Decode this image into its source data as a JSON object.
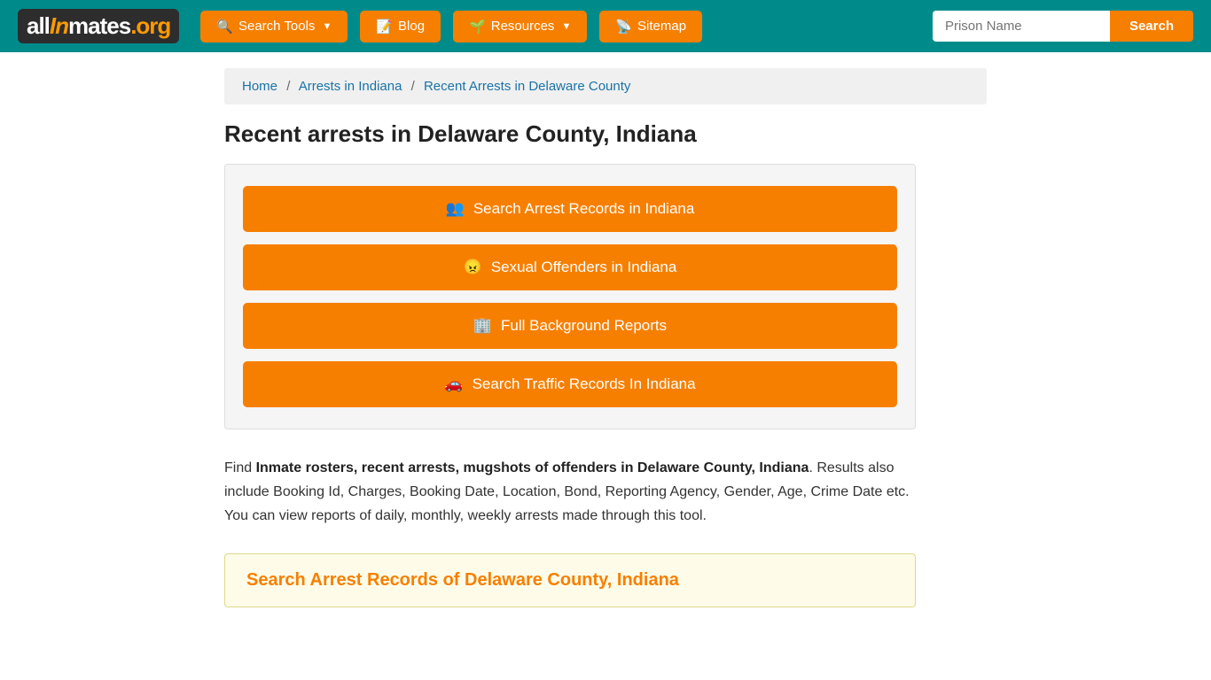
{
  "header": {
    "logo": {
      "part1": "all",
      "part2": "In",
      "part3": "mates",
      "part4": ".org"
    },
    "nav": [
      {
        "id": "search-tools",
        "label": "Search Tools",
        "icon": "🔍",
        "hasDropdown": true
      },
      {
        "id": "blog",
        "label": "Blog",
        "icon": "📝",
        "hasDropdown": false
      },
      {
        "id": "resources",
        "label": "Resources",
        "icon": "🌱",
        "hasDropdown": true
      },
      {
        "id": "sitemap",
        "label": "Sitemap",
        "icon": "📡",
        "hasDropdown": false
      }
    ],
    "search": {
      "placeholder": "Prison Name",
      "button_label": "Search"
    }
  },
  "breadcrumb": {
    "items": [
      {
        "label": "Home",
        "href": "#"
      },
      {
        "label": "Arrests in Indiana",
        "href": "#"
      },
      {
        "label": "Recent Arrests in Delaware County",
        "href": "#",
        "current": true
      }
    ]
  },
  "page": {
    "title": "Recent arrests in Delaware County, Indiana",
    "tool_buttons": [
      {
        "id": "arrest-records",
        "icon": "👥",
        "label": "Search Arrest Records in Indiana"
      },
      {
        "id": "sexual-offenders",
        "icon": "😠",
        "label": "Sexual Offenders in Indiana"
      },
      {
        "id": "background-reports",
        "icon": "🏢",
        "label": "Full Background Reports"
      },
      {
        "id": "traffic-records",
        "icon": "🚗",
        "label": "Search Traffic Records In Indiana"
      }
    ],
    "description": {
      "intro": "Find ",
      "bold_text": "Inmate rosters, recent arrests, mugshots of offenders in Delaware County, Indiana",
      "rest": ". Results also include Booking Id, Charges, Booking Date, Location, Bond, Reporting Agency, Gender, Age, Crime Date etc. You can view reports of daily, monthly, weekly arrests made through this tool."
    },
    "search_section_title": "Search Arrest Records of Delaware County, Indiana"
  }
}
